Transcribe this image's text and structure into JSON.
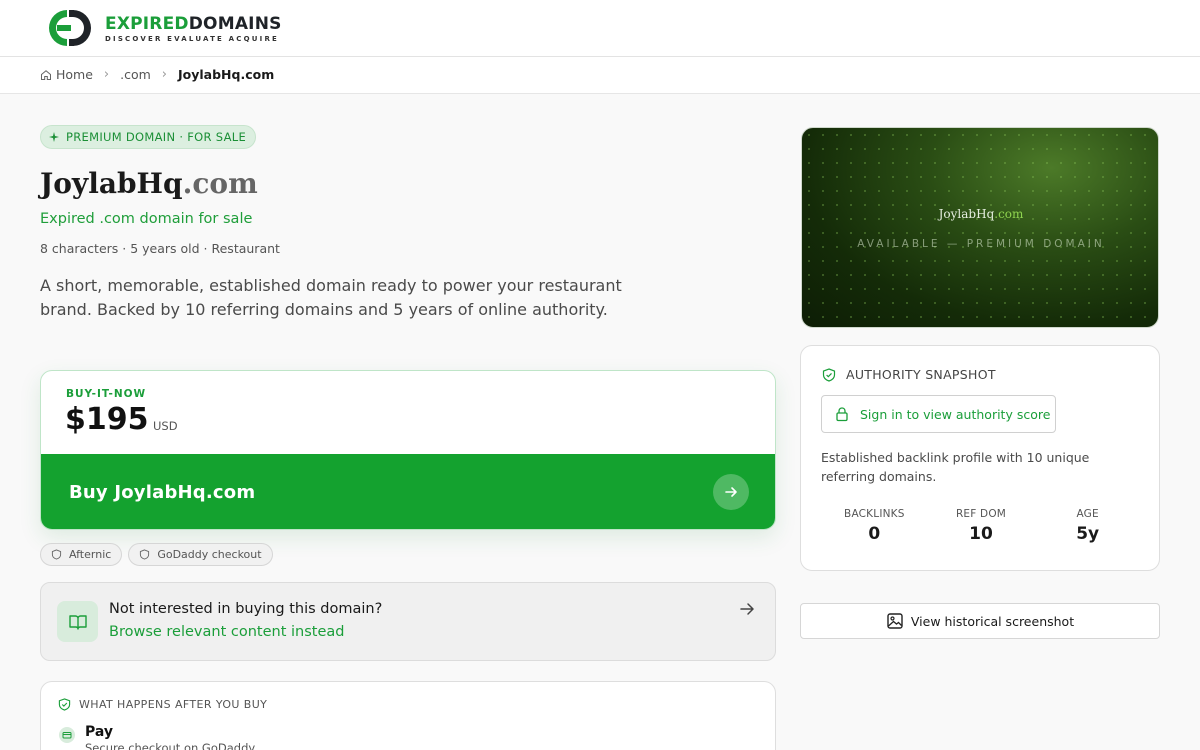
{
  "brand": {
    "name_part1": "EXPIRED",
    "name_part2": "DOMAINS",
    "tagline": "DISCOVER EVALUATE ACQUIRE",
    "accent": "#1b9e3a"
  },
  "breadcrumb": {
    "home": "Home",
    "tld": ".com",
    "current": "JoylabHq.com"
  },
  "domain": {
    "badge": "PREMIUM DOMAIN · FOR SALE",
    "name": "JoylabHq",
    "tld": ".com",
    "subtitle": "Expired .com domain for sale",
    "meta": "8 characters · 5 years old · Restaurant",
    "description": "A short, memorable, established domain ready to power your restaurant brand. Backed by 10 referring domains and 5 years of online authority."
  },
  "purchase": {
    "label": "BUY-IT-NOW",
    "price": "$195",
    "currency": "USD",
    "button": "Buy JoylabHq.com",
    "button_color": "#14a22f"
  },
  "marketplaces": [
    "Afternic",
    "GoDaddy checkout"
  ],
  "alternative": {
    "question": "Not interested in buying this domain?",
    "link": "Browse relevant content instead"
  },
  "after_buy": {
    "heading": "WHAT HAPPENS AFTER YOU BUY",
    "steps": [
      {
        "title": "Pay",
        "desc": "Secure checkout on GoDaddy"
      }
    ]
  },
  "hero": {
    "name": "JoylabHq",
    "tld": ".com",
    "subtitle": "AVAILABLE — PREMIUM DOMAIN"
  },
  "authority": {
    "heading": "AUTHORITY SNAPSHOT",
    "signin": "Sign in to view authority score",
    "description": "Established backlink profile with 10 unique referring domains.",
    "stats": [
      {
        "label": "BACKLINKS",
        "value": "0"
      },
      {
        "label": "REF DOM",
        "value": "10"
      },
      {
        "label": "AGE",
        "value": "5y"
      }
    ]
  },
  "history_button": "View historical screenshot"
}
